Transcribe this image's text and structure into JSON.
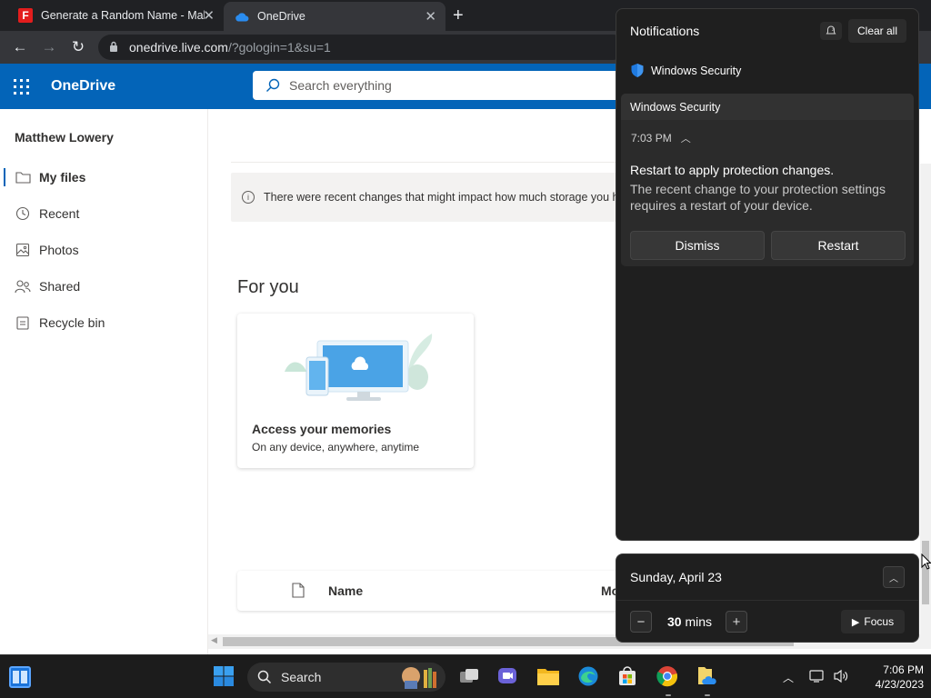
{
  "browser": {
    "tabs": [
      {
        "title": "Generate a Random Name - Mal",
        "favicon": "F"
      },
      {
        "title": "OneDrive",
        "favicon": "onedrive-cloud"
      }
    ],
    "url_host": "onedrive.live.com",
    "url_rest": "/?gologin=1&su=1"
  },
  "onedrive": {
    "brand": "OneDrive",
    "search_placeholder": "Search everything",
    "user_name": "Matthew Lowery",
    "nav": [
      {
        "label": "My files",
        "icon": "folder-icon"
      },
      {
        "label": "Recent",
        "icon": "clock-icon"
      },
      {
        "label": "Photos",
        "icon": "image-icon"
      },
      {
        "label": "Shared",
        "icon": "people-icon"
      },
      {
        "label": "Recycle bin",
        "icon": "trash-icon"
      }
    ],
    "info_text": "There were recent changes that might impact how much storage you hav",
    "for_you": "For you",
    "card_title": "Access your memories",
    "card_subtitle": "On any device, anywhere, anytime",
    "col_name": "Name",
    "col_modified": "Mo"
  },
  "notifications": {
    "title": "Notifications",
    "clear_all": "Clear all",
    "app_name": "Windows Security",
    "toast_header": "Windows Security",
    "time": "7:03 PM",
    "toast_title": "Restart to apply protection changes.",
    "toast_body": "The recent change to your protection settings requires a restart of your device.",
    "dismiss": "Dismiss",
    "restart": "Restart"
  },
  "calendar": {
    "date": "Sunday, April 23",
    "focus_minutes": "30",
    "focus_unit": "mins",
    "focus_label": "Focus"
  },
  "taskbar": {
    "search_label": "Search",
    "time": "7:06 PM",
    "date": "4/23/2023"
  },
  "colors": {
    "onedrive_blue": "#0364b8",
    "panel_bg": "#1f1f1f",
    "security_shield": "#1f7ae0"
  }
}
